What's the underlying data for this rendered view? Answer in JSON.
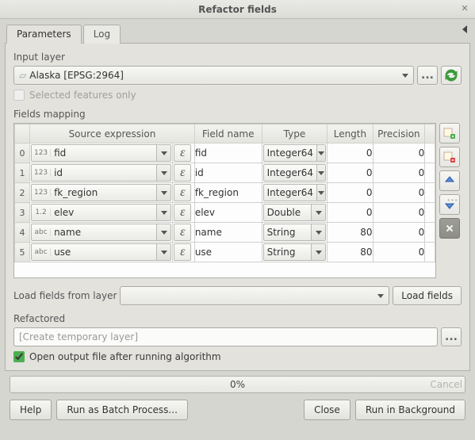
{
  "window": {
    "title": "Refactor fields"
  },
  "tabs": {
    "parameters": "Parameters",
    "log": "Log"
  },
  "inputLayer": {
    "label": "Input layer",
    "value": "Alaska [EPSG:2964]",
    "selectedOnly": "Selected features only"
  },
  "fieldsMapping": {
    "label": "Fields mapping",
    "cols": {
      "idx": "",
      "expr": "Source expression",
      "name": "Field name",
      "type": "Type",
      "len": "Length",
      "prec": "Precision"
    },
    "rows": [
      {
        "idx": "0",
        "exprTag": "123",
        "expr": "fid",
        "name": "fid",
        "type": "Integer64",
        "len": "0",
        "prec": "0"
      },
      {
        "idx": "1",
        "exprTag": "123",
        "expr": "id",
        "name": "id",
        "type": "Integer64",
        "len": "0",
        "prec": "0"
      },
      {
        "idx": "2",
        "exprTag": "123",
        "expr": "fk_region",
        "name": "fk_region",
        "type": "Integer64",
        "len": "0",
        "prec": "0"
      },
      {
        "idx": "3",
        "exprTag": "1.2",
        "expr": "elev",
        "name": "elev",
        "type": "Double",
        "len": "0",
        "prec": "0"
      },
      {
        "idx": "4",
        "exprTag": "abc",
        "expr": "name",
        "name": "name",
        "type": "String",
        "len": "80",
        "prec": "0"
      },
      {
        "idx": "5",
        "exprTag": "abc",
        "expr": "use",
        "name": "use",
        "type": "String",
        "len": "80",
        "prec": "0"
      }
    ]
  },
  "loadFrom": {
    "label": "Load fields from layer",
    "btn": "Load fields"
  },
  "refactored": {
    "label": "Refactored",
    "placeholder": "[Create temporary layer]"
  },
  "openAfter": "Open output file after running algorithm",
  "progress": {
    "text": "0%",
    "cancel": "Cancel"
  },
  "buttons": {
    "help": "Help",
    "batch": "Run as Batch Process...",
    "close": "Close",
    "runbg": "Run in Background"
  },
  "icons": {
    "ellipsis": "...",
    "epsilon": "ε"
  }
}
